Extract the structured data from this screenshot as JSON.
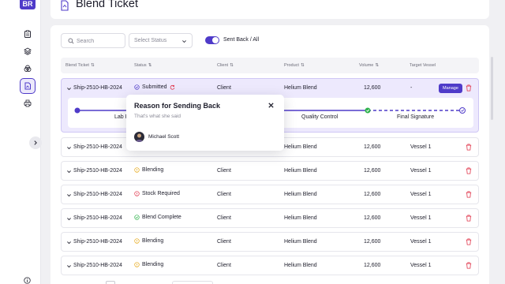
{
  "app": {
    "logo": "BR",
    "title": "Blend Ticket"
  },
  "sidebar": {
    "items": [
      {
        "icon": "clipboard-icon"
      },
      {
        "icon": "layers-icon"
      },
      {
        "icon": "stack-icon"
      },
      {
        "icon": "blend-document-icon",
        "active": true
      },
      {
        "icon": "printer-icon"
      }
    ],
    "expand_icon": "chevron-right-icon",
    "info_icon": "info-icon"
  },
  "filters": {
    "search_placeholder": "Search",
    "status_placeholder": "Select Status",
    "toggle_label": "Sent Back / All",
    "toggle_on": true
  },
  "table": {
    "columns": [
      "Blend Ticket",
      "Status",
      "Client",
      "Product",
      "Volume",
      "Target Vessel"
    ],
    "rows": [
      {
        "ticket": "Ship-2510-HB-2024",
        "status": "Submitted",
        "status_type": "submitted",
        "client": "Client",
        "product": "Helium Blend",
        "volume": "12,600",
        "vessel": "-",
        "expanded": true,
        "action": "Manage"
      },
      {
        "ticket": "Ship-2510-HB-2024",
        "status": "",
        "status_type": "none",
        "client": "",
        "product": "Helium Blend",
        "volume": "12,600",
        "vessel": "Vessel 1"
      },
      {
        "ticket": "Ship-2510-HB-2024",
        "status": "Blending",
        "status_type": "blending",
        "client": "Client",
        "product": "Helium Blend",
        "volume": "12,600",
        "vessel": "Vessel 1"
      },
      {
        "ticket": "Ship-2510-HB-2024",
        "status": "Stock Required",
        "status_type": "stock",
        "client": "Client",
        "product": "Helium Blend",
        "volume": "12,600",
        "vessel": "Vessel 1"
      },
      {
        "ticket": "Ship-2510-HB-2024",
        "status": "Blend Complete",
        "status_type": "complete",
        "client": "Client",
        "product": "Helium Blend",
        "volume": "12,600",
        "vessel": "Vessel 1"
      },
      {
        "ticket": "Ship-2510-HB-2024",
        "status": "Blending",
        "status_type": "blending",
        "client": "Client",
        "product": "Helium Blend",
        "volume": "12,600",
        "vessel": "Vessel 1"
      },
      {
        "ticket": "Ship-2510-HB-2024",
        "status": "Blending",
        "status_type": "blending",
        "client": "Client",
        "product": "Helium Blend",
        "volume": "12,600",
        "vessel": "Vessel 1"
      }
    ]
  },
  "progress": {
    "steps": [
      "Lab R",
      "Quality Control",
      "Final Signature"
    ]
  },
  "popover": {
    "title": "Reason for Sending Back",
    "message": "That's what she said",
    "user": "Michael Scott"
  },
  "colors": {
    "accent": "#4f3bc9",
    "danger": "#e0344a",
    "success": "#2fb24c",
    "warning": "#e6a817",
    "expanded_row_bg": "#ede9fd"
  }
}
